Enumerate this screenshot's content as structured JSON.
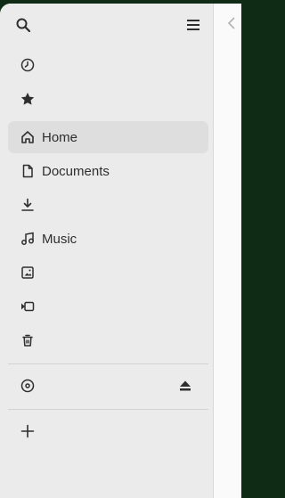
{
  "sidebar": {
    "items": [
      {
        "name": "recent",
        "icon": "clock-icon",
        "label": ""
      },
      {
        "name": "starred",
        "icon": "star-icon",
        "label": ""
      },
      {
        "name": "home",
        "icon": "home-icon",
        "label": "Home",
        "active": true
      },
      {
        "name": "documents",
        "icon": "document-icon",
        "label": "Documents"
      },
      {
        "name": "downloads",
        "icon": "download-icon",
        "label": ""
      },
      {
        "name": "music",
        "icon": "music-icon",
        "label": "Music"
      },
      {
        "name": "pictures",
        "icon": "picture-icon",
        "label": ""
      },
      {
        "name": "videos",
        "icon": "video-icon",
        "label": ""
      },
      {
        "name": "trash",
        "icon": "trash-icon",
        "label": ""
      }
    ],
    "device": {
      "icon": "disc-icon",
      "label": "",
      "action_icon": "eject-icon"
    },
    "other_locations": {
      "icon": "plus-icon",
      "label": ""
    }
  },
  "colors": {
    "titlebar_bg": "#0f2b16",
    "sidebar_bg": "#ebebeb",
    "active_row": "#dedede",
    "content_bg": "#fafafa"
  }
}
